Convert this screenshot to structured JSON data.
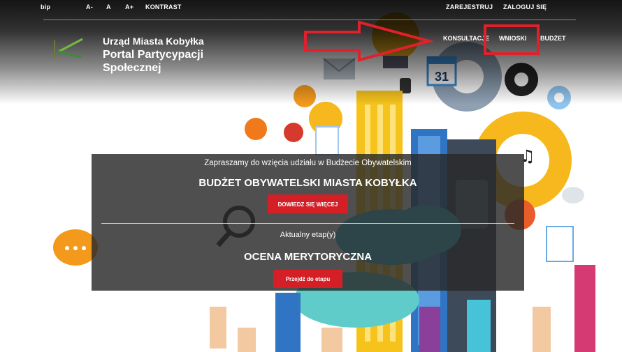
{
  "topbar": {
    "bip": "bip",
    "font_smaller": "A-",
    "font_normal": "A",
    "font_larger": "A+",
    "contrast": "KONTRAST",
    "register": "ZAREJESTRUJ",
    "login": "ZALOGUJ SIĘ"
  },
  "header": {
    "org_name": "Urząd Miasta Kobyłka",
    "portal_title": "Portal Partycypacji Społecznej",
    "nav": [
      {
        "label": "KONSULTACJE"
      },
      {
        "label": "WNIOSKI"
      },
      {
        "label": "BUDŻET"
      }
    ]
  },
  "panel": {
    "invite": "Zapraszamy do wzięcia udziału w Budżecie Obywatelskim",
    "budget_title": "BUDŻET OBYWATELSKI MIASTA KOBYŁKA",
    "more_button": "DOWIEDZ SIĘ WIĘCEJ",
    "stage_label": "Aktualny etap(y)",
    "stage_name": "OCENA MERYTORYCZNA",
    "stage_button": "Przejdź do etapu"
  },
  "illustration": {
    "calendar_day": "31"
  },
  "colors": {
    "accent_red": "#d41f26",
    "highlight_red": "#e0202a",
    "panel_bg": "#282828"
  }
}
